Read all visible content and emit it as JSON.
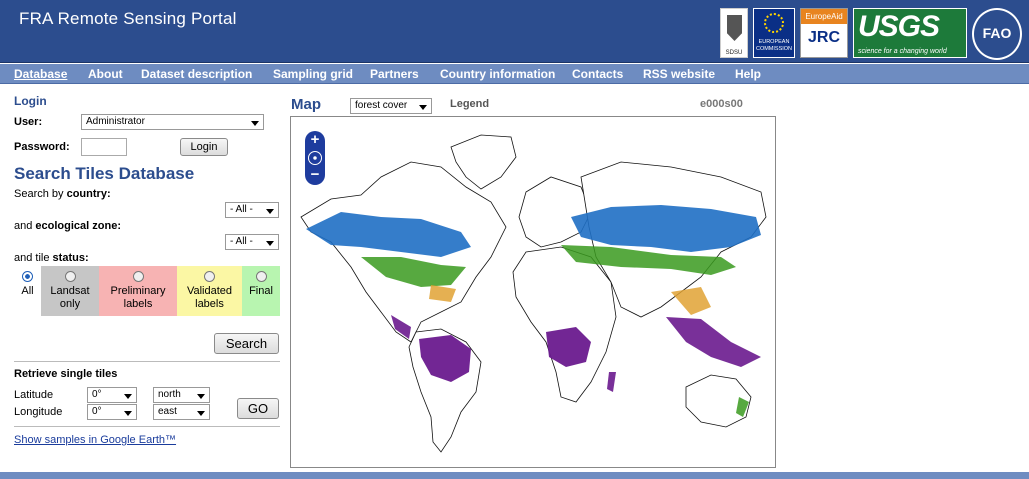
{
  "header": {
    "title": "FRA Remote Sensing Portal",
    "logos": [
      {
        "name": "SDSU",
        "text": "SDSU"
      },
      {
        "name": "European Commission",
        "text": "EUROPEAN COMMISSION"
      },
      {
        "name": "JRC",
        "bar": "EuropeAid",
        "text": "JRC"
      },
      {
        "name": "USGS",
        "text": "USGS",
        "tagline": "science for a changing world"
      },
      {
        "name": "FAO",
        "text": "FAO"
      }
    ]
  },
  "nav": {
    "items": [
      "Database",
      "About",
      "Dataset description",
      "Sampling grid",
      "Partners",
      "Country information",
      "Contacts",
      "RSS website",
      "Help"
    ],
    "active": "Database"
  },
  "login": {
    "heading": "Login",
    "user_label": "User:",
    "user_value": "Administrator",
    "password_label": "Password:",
    "button": "Login"
  },
  "search": {
    "heading": "Search Tiles Database",
    "country_prefix": "Search by",
    "country_bold": "country",
    "country_suffix": ":",
    "country_value": "- All -",
    "eco_prefix": "and",
    "eco_bold": "ecological zone",
    "eco_suffix": ":",
    "eco_value": "- All -",
    "status_prefix": "and tile",
    "status_bold": "status",
    "status_suffix": ":",
    "statuses": [
      {
        "label1": "All",
        "label2": "",
        "color": "#ffffff",
        "checked": true
      },
      {
        "label1": "Landsat",
        "label2": "only",
        "color": "#c6c6c6",
        "checked": false
      },
      {
        "label1": "Preliminary",
        "label2": "labels",
        "color": "#f7b3b3",
        "checked": false
      },
      {
        "label1": "Validated",
        "label2": "labels",
        "color": "#fbf7a4",
        "checked": false
      },
      {
        "label1": "Final",
        "label2": "",
        "color": "#b8f5b0",
        "checked": false
      }
    ],
    "button": "Search"
  },
  "retrieve": {
    "heading": "Retrieve single tiles",
    "latitude_label": "Latitude",
    "latitude_value": "0°",
    "latitude_dir": "north",
    "longitude_label": "Longitude",
    "longitude_value": "0°",
    "longitude_dir": "east",
    "button": "GO"
  },
  "google_link": "Show samples in Google Earth™",
  "map": {
    "title": "Map",
    "layer": "forest cover",
    "legend": "Legend",
    "tile_code": "e000s00",
    "zoom_in": "+",
    "zoom_out": "−"
  },
  "colors": {
    "header_bg": "#2c4d8e",
    "nav_bg": "#6e8cc1",
    "boreal_blue": "#1f6fc4",
    "temperate_green": "#3a9a1e",
    "subtropical_orange": "#e0a234",
    "tropical_purple": "#6a1a8e"
  }
}
